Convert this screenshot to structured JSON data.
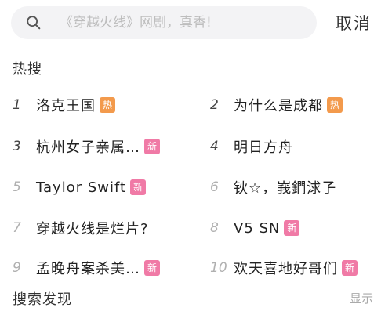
{
  "search": {
    "placeholder": "《穿越火线》网剧，真香!",
    "cancel_label": "取消"
  },
  "hot_search": {
    "title": "热搜",
    "items": [
      {
        "rank": "1",
        "text": "洛克王国",
        "badge": "热",
        "badge_type": "hot"
      },
      {
        "rank": "2",
        "text": "为什么是成都",
        "badge": "热",
        "badge_type": "hot"
      },
      {
        "rank": "3",
        "text": "杭州女子亲属…",
        "badge": "新",
        "badge_type": "new"
      },
      {
        "rank": "4",
        "text": "明日方舟",
        "badge": "",
        "badge_type": ""
      },
      {
        "rank": "5",
        "text": "Taylor Swift",
        "badge": "新",
        "badge_type": "new"
      },
      {
        "rank": "6",
        "text": "钬☆，峩鍆浗孒",
        "badge": "",
        "badge_type": ""
      },
      {
        "rank": "7",
        "text": "穿越火线是烂片?",
        "badge": "",
        "badge_type": ""
      },
      {
        "rank": "8",
        "text": "V5 SN",
        "badge": "新",
        "badge_type": "new"
      },
      {
        "rank": "9",
        "text": "孟晚舟案杀美…",
        "badge": "新",
        "badge_type": "new"
      },
      {
        "rank": "10",
        "text": "欢天喜地好哥们",
        "badge": "新",
        "badge_type": "new"
      }
    ]
  },
  "discover": {
    "title": "搜索发现",
    "toggle_label": "显示"
  },
  "colors": {
    "hot_badge": "#f39a4c",
    "new_badge": "#f07aa6",
    "search_bg": "#f3f3f5"
  }
}
